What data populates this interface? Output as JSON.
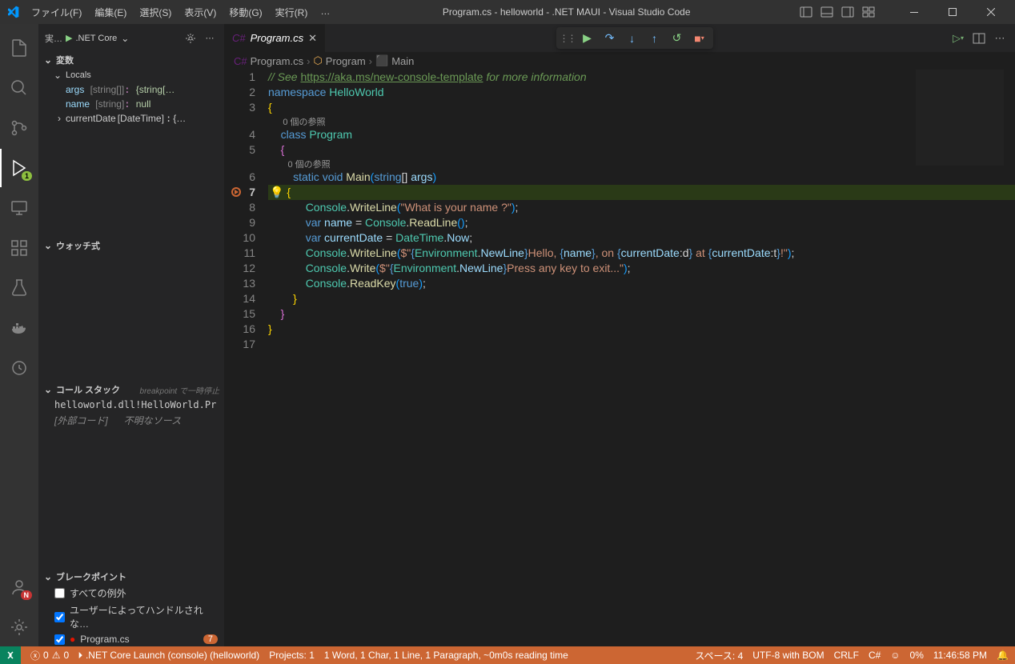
{
  "titlebar": {
    "menu": [
      "ファイル(F)",
      "編集(E)",
      "選択(S)",
      "表示(V)",
      "移動(G)",
      "実行(R)",
      "…"
    ],
    "title": "Program.cs - helloworld - .NET MAUI - Visual Studio Code"
  },
  "sidebar": {
    "topLabel": "実…",
    "config": ".NET Core",
    "sections": {
      "vars": "変数",
      "locals": "Locals",
      "watch": "ウォッチ式",
      "callstack": "コール スタック",
      "callstackHint": "breakpoint で一時停止",
      "breakpoints": "ブレークポイント"
    },
    "locals": [
      {
        "name": "args",
        "type": "[string[]]",
        "val": "{string[…"
      },
      {
        "name": "name",
        "type": "[string]",
        "val": "null"
      },
      {
        "name": "currentDate",
        "type": "[DateTime]",
        "val": "{…",
        "exp": true
      }
    ],
    "callstack": [
      {
        "text": "helloworld.dll!HelloWorld.Pr"
      },
      {
        "left": "[外部コード]",
        "right": "不明なソース"
      }
    ],
    "bps": {
      "all": "すべての例外",
      "user": "ユーザーによってハンドルされな…",
      "file": "Program.cs",
      "badge": "7"
    }
  },
  "tab": {
    "name": "Program.cs"
  },
  "breadcrumb": [
    "Program.cs",
    "Program",
    "Main"
  ],
  "code": {
    "codelens": "0 個の参照",
    "lines": [
      {
        "n": 1
      },
      {
        "n": 2
      },
      {
        "n": 3
      },
      {
        "cl": true
      },
      {
        "n": 4
      },
      {
        "n": 5
      },
      {
        "cl": true
      },
      {
        "n": 6
      },
      {
        "n": 7,
        "cur": true,
        "bp": true
      },
      {
        "n": 8
      },
      {
        "n": 9
      },
      {
        "n": 10
      },
      {
        "n": 11
      },
      {
        "n": 12
      },
      {
        "n": 13
      },
      {
        "n": 14
      },
      {
        "n": 15
      },
      {
        "n": 16
      },
      {
        "n": 17
      }
    ],
    "comment_pre": "// See ",
    "comment_url": "https://aka.ms/new-console-template",
    "comment_post": " for more information",
    "ns": "namespace",
    "nsname": "HelloWorld",
    "cls": "class",
    "clsname": "Program",
    "static": "static",
    "void": "void",
    "main": "Main",
    "stringArr": "string",
    "args": "args",
    "c": "Console",
    "wl": "WriteLine",
    "wr": "Write",
    "rl": "ReadLine",
    "rk": "ReadKey",
    "s1": "\"What is your name ?\"",
    "var": "var",
    "name": "name",
    "cd": "currentDate",
    "dt": "DateTime",
    "now": "Now",
    "env": "Environment",
    "nl": "NewLine",
    "hello": "Hello, ",
    "on": ", on ",
    "at": " at ",
    "ex": "!",
    "press": "Press any key to exit...",
    "true": "true"
  },
  "status": {
    "errors": "0",
    "warnings": "0",
    "launch": ".NET Core Launch (console) (helloworld)",
    "projects": "Projects: 1",
    "readtime": "1 Word, 1 Char, 1 Line, 1 Paragraph, ~0m0s reading time",
    "spaces": "スペース: 4",
    "enc": "UTF-8 with BOM",
    "eol": "CRLF",
    "lang": "C#",
    "pct": "0%",
    "time": "11:46:58 PM"
  }
}
